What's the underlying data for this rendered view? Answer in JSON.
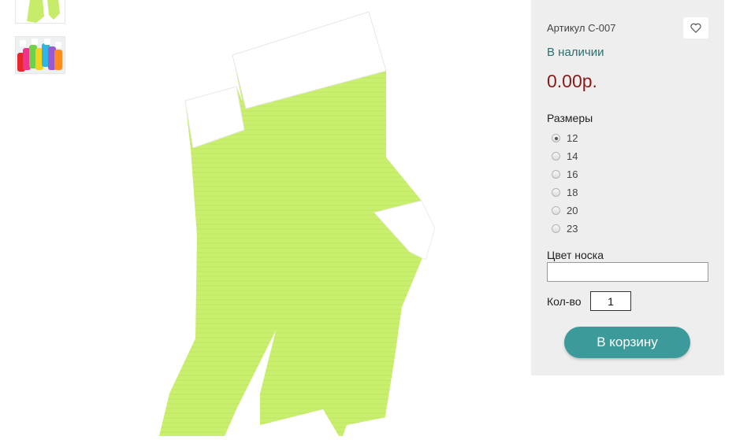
{
  "gallery": {
    "thumbnails": [
      {
        "icon": "green-sock-thumbnail"
      },
      {
        "icon": "multicolor-socks-thumbnail"
      }
    ],
    "main_image": {
      "icon": "green-socks-photo",
      "colors": {
        "sock": "#c9ef6e",
        "trim": "#ffffff"
      }
    }
  },
  "product": {
    "sku_label": "Артикул С-007",
    "stock_status": "В наличии",
    "price": "0.00р.",
    "favorite_icon": "heart-icon"
  },
  "sizes": {
    "title": "Размеры",
    "options": [
      {
        "label": "12",
        "checked": true
      },
      {
        "label": "14",
        "checked": false
      },
      {
        "label": "16",
        "checked": false
      },
      {
        "label": "18",
        "checked": false
      },
      {
        "label": "20",
        "checked": false
      },
      {
        "label": "23",
        "checked": false
      }
    ]
  },
  "color": {
    "label": "Цвет носка",
    "value": ""
  },
  "quantity": {
    "label": "Кол-во",
    "value": "1"
  },
  "cart": {
    "button_label": "В корзину"
  },
  "colors": {
    "accent": "#3d9a9b",
    "price": "#8b1a1a",
    "stock": "#2a6f6f",
    "panel_bg": "#eeeeee"
  }
}
